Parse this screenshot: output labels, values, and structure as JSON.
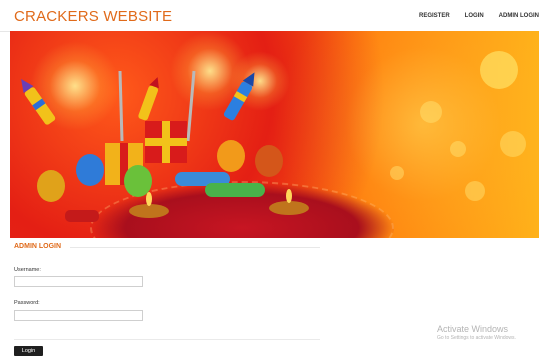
{
  "header": {
    "brand": "CRACKERS WEBSITE",
    "nav": [
      {
        "label": "REGISTER"
      },
      {
        "label": "LOGIN"
      },
      {
        "label": "ADMIN LOGIN"
      }
    ]
  },
  "admin_login": {
    "title": "ADMIN LOGIN",
    "username_label": "Username:",
    "username_value": "",
    "password_label": "Password:",
    "password_value": "",
    "button_label": "Login"
  },
  "watermark": {
    "title": "Activate Windows",
    "subtitle": "Go to Settings to activate Windows."
  },
  "colors": {
    "brand": "#e06a1a",
    "button": "#1f1f1f"
  }
}
